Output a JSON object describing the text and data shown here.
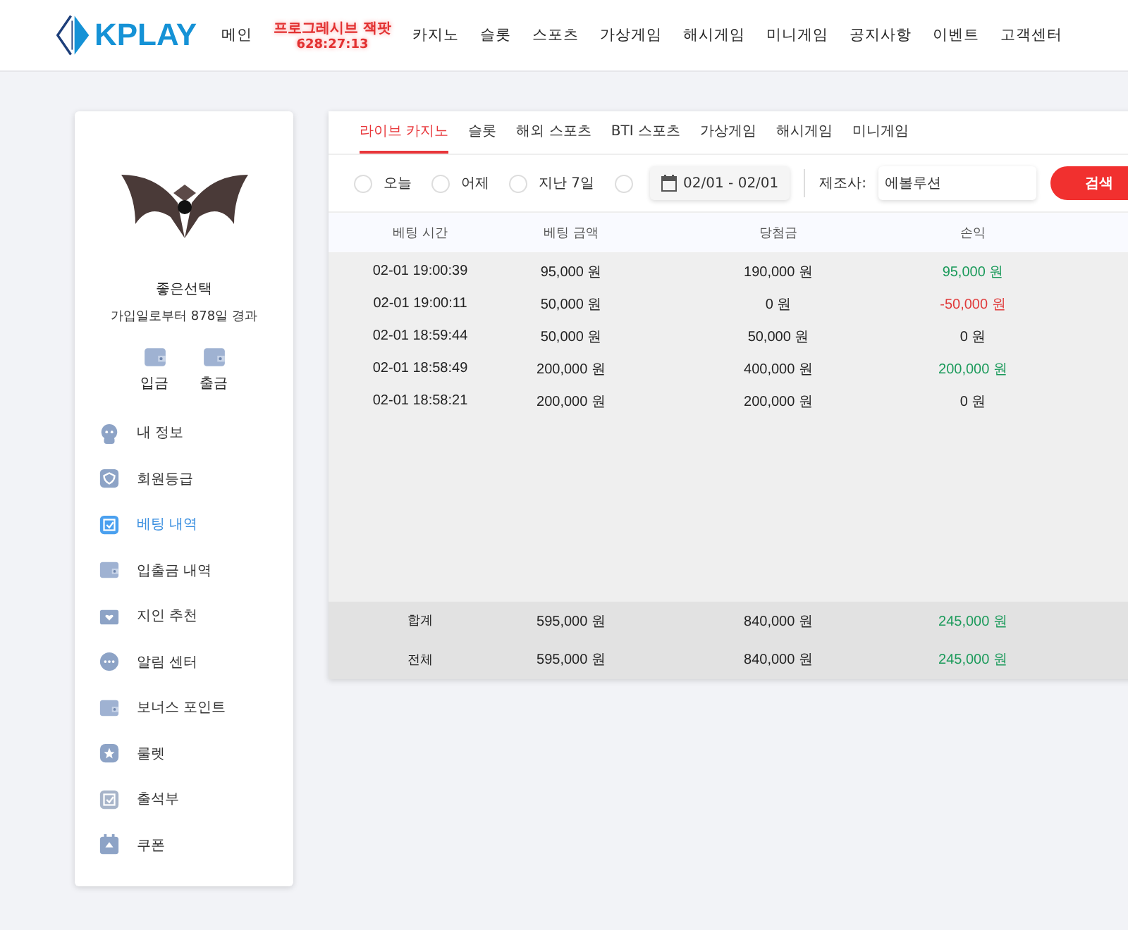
{
  "header": {
    "logo": "KPLAY",
    "nav": [
      {
        "label": "메인"
      },
      {
        "label": "프로그레시브 잭팟",
        "sub": "628:27:13"
      },
      {
        "label": "카지노"
      },
      {
        "label": "슬롯"
      },
      {
        "label": "스포츠"
      },
      {
        "label": "가상게임"
      },
      {
        "label": "해시게임"
      },
      {
        "label": "미니게임"
      },
      {
        "label": "공지사항"
      },
      {
        "label": "이벤트"
      },
      {
        "label": "고객센터"
      }
    ]
  },
  "sidebar": {
    "username": "좋은선택",
    "member_since": "가입일로부터 878일 경과",
    "actions": [
      {
        "label": "입금"
      },
      {
        "label": "출금"
      }
    ],
    "items": [
      {
        "label": "내 정보",
        "selected": false
      },
      {
        "label": "회원등급",
        "selected": false
      },
      {
        "label": "베팅 내역",
        "selected": true
      },
      {
        "label": "입출금 내역",
        "selected": false
      },
      {
        "label": "지인 추천",
        "selected": false
      },
      {
        "label": "알림 센터",
        "selected": false
      },
      {
        "label": "보너스 포인트",
        "selected": false
      },
      {
        "label": "룰렛",
        "selected": false
      },
      {
        "label": "출석부",
        "selected": false
      },
      {
        "label": "쿠폰",
        "selected": false
      }
    ]
  },
  "tabs": [
    {
      "label": "라이브 카지노",
      "selected": true
    },
    {
      "label": "슬롯",
      "selected": false
    },
    {
      "label": "해외 스포츠",
      "selected": false
    },
    {
      "label": "BTI 스포츠",
      "selected": false
    },
    {
      "label": "가상게임",
      "selected": false
    },
    {
      "label": "해시게임",
      "selected": false
    },
    {
      "label": "미니게임",
      "selected": false
    }
  ],
  "filters": {
    "periods": [
      {
        "label": "오늘",
        "selected": false
      },
      {
        "label": "어제",
        "selected": false
      },
      {
        "label": "지난 7일",
        "selected": false
      },
      {
        "selected": false
      }
    ],
    "date_range": "02/01 - 02/01",
    "provider_label": "제조사:",
    "provider_value": "에볼루션",
    "search_button": "검색"
  },
  "table": {
    "columns": [
      "베팅 시간",
      "베팅 금액",
      "당첨금",
      "손익"
    ],
    "rows": [
      {
        "cells": [
          "02-01 19:00:39",
          "95,000 원",
          "190,000 원",
          "95,000 원"
        ],
        "color": "#1a9a5a"
      },
      {
        "cells": [
          "02-01 19:00:11",
          "50,000 원",
          "0 원",
          "-50,000 원"
        ],
        "color": "#e03a3a"
      },
      {
        "cells": [
          "02-01 18:59:44",
          "50,000 원",
          "50,000 원",
          "0 원"
        ],
        "color": "#222222"
      },
      {
        "cells": [
          "02-01 18:58:49",
          "200,000 원",
          "400,000 원",
          "200,000 원"
        ],
        "color": "#1a9a5a"
      },
      {
        "cells": [
          "02-01 18:58:21",
          "200,000 원",
          "200,000 원",
          "0 원"
        ],
        "color": "#222222"
      }
    ],
    "totals": [
      {
        "cells": [
          "합계",
          "595,000 원",
          "840,000 원",
          "245,000 원"
        ],
        "color": "#1a9a5a"
      },
      {
        "cells": [
          "전체",
          "595,000 원",
          "840,000 원",
          "245,000 원"
        ],
        "color": "#1a9a5a"
      }
    ]
  }
}
